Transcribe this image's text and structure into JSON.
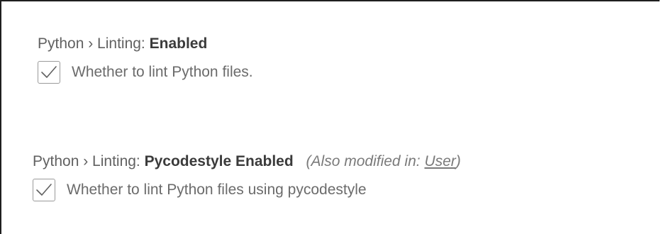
{
  "settings": [
    {
      "category": "Python › Linting:",
      "name": "Enabled",
      "description": "Whether to lint Python files.",
      "checked": true,
      "check_icon": "checkmark-icon"
    },
    {
      "category": "Python › Linting:",
      "name": "Pycodestyle Enabled",
      "modified_prefix": "(Also modified in: ",
      "modified_link": "User",
      "modified_suffix": ")",
      "description": "Whether to lint Python files using pycodestyle",
      "checked": true,
      "check_icon": "checkmark-icon"
    }
  ]
}
